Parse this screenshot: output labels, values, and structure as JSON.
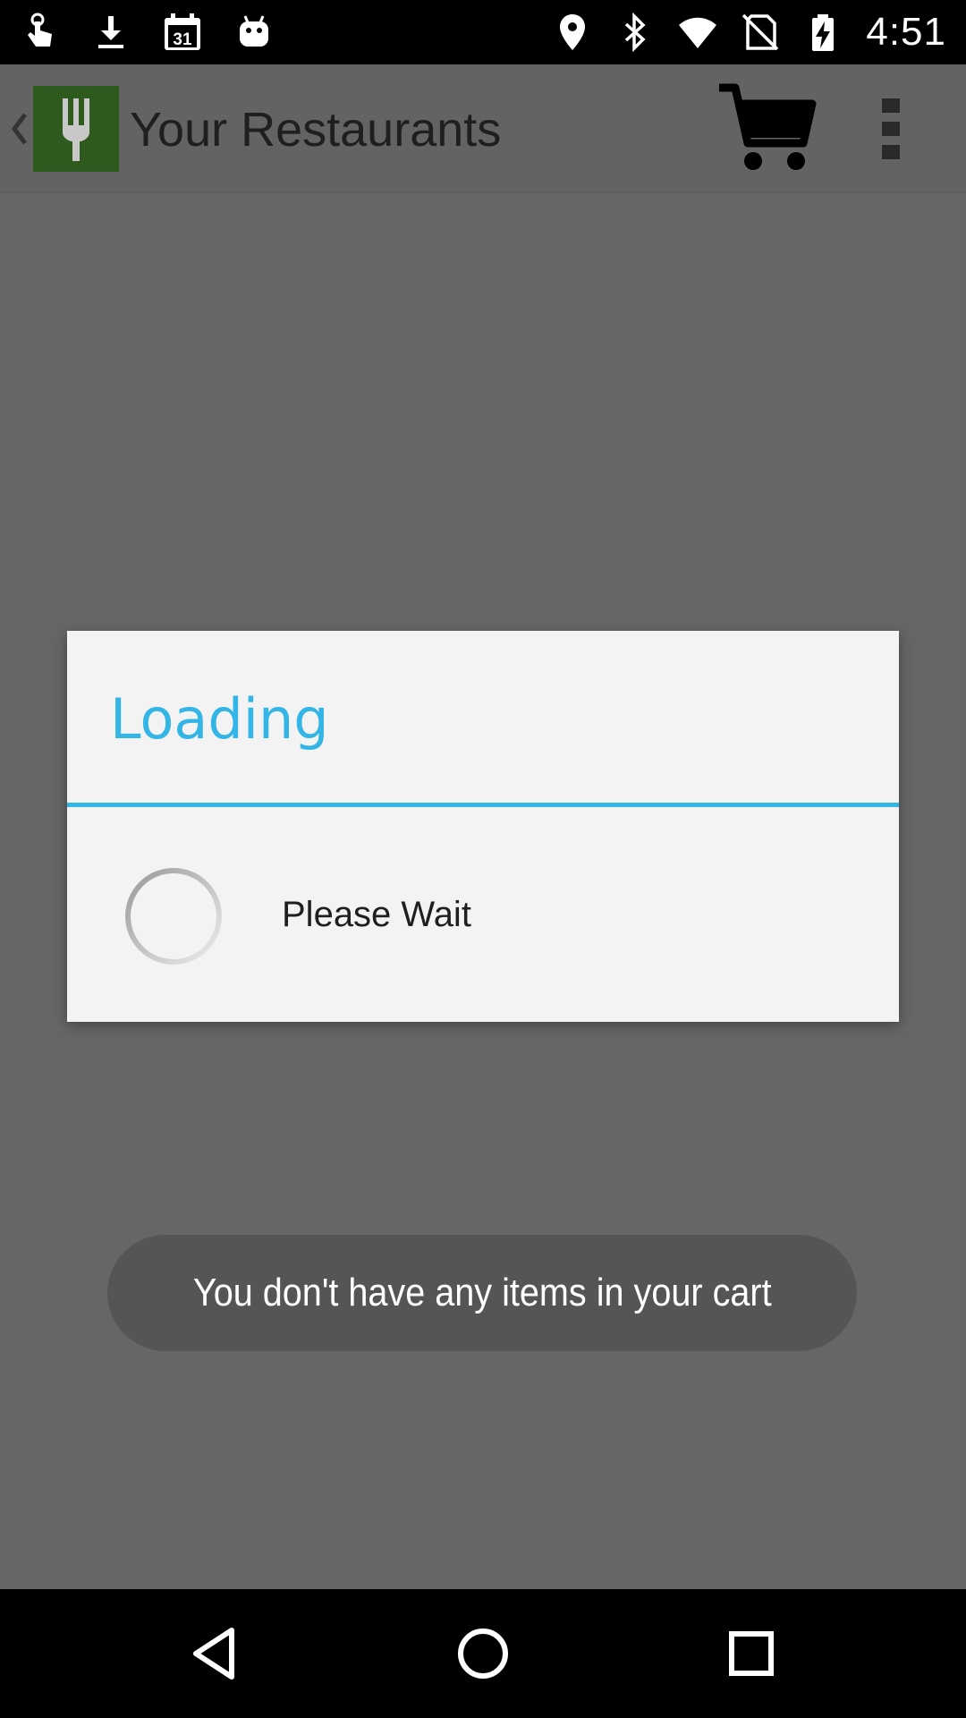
{
  "status_bar": {
    "time": "4:51",
    "calendar_day": "31",
    "left_icons": [
      "touch-icon",
      "download-icon",
      "calendar-icon",
      "android-icon"
    ],
    "right_icons": [
      "location-icon",
      "bluetooth-icon",
      "wifi-icon",
      "no-sim-icon",
      "battery-charging-icon"
    ]
  },
  "action_bar": {
    "title": "Your Restaurants",
    "logo_icon": "fork-icon",
    "cart_icon": "cart-icon",
    "overflow_icon": "overflow-menu-icon"
  },
  "dialog": {
    "title": "Loading",
    "message": "Please Wait",
    "accent_color": "#33b5e5"
  },
  "toast": {
    "message": "You don't have any items in your cart"
  },
  "nav_bar": {
    "icons": [
      "back-icon",
      "home-icon",
      "recents-icon"
    ]
  }
}
